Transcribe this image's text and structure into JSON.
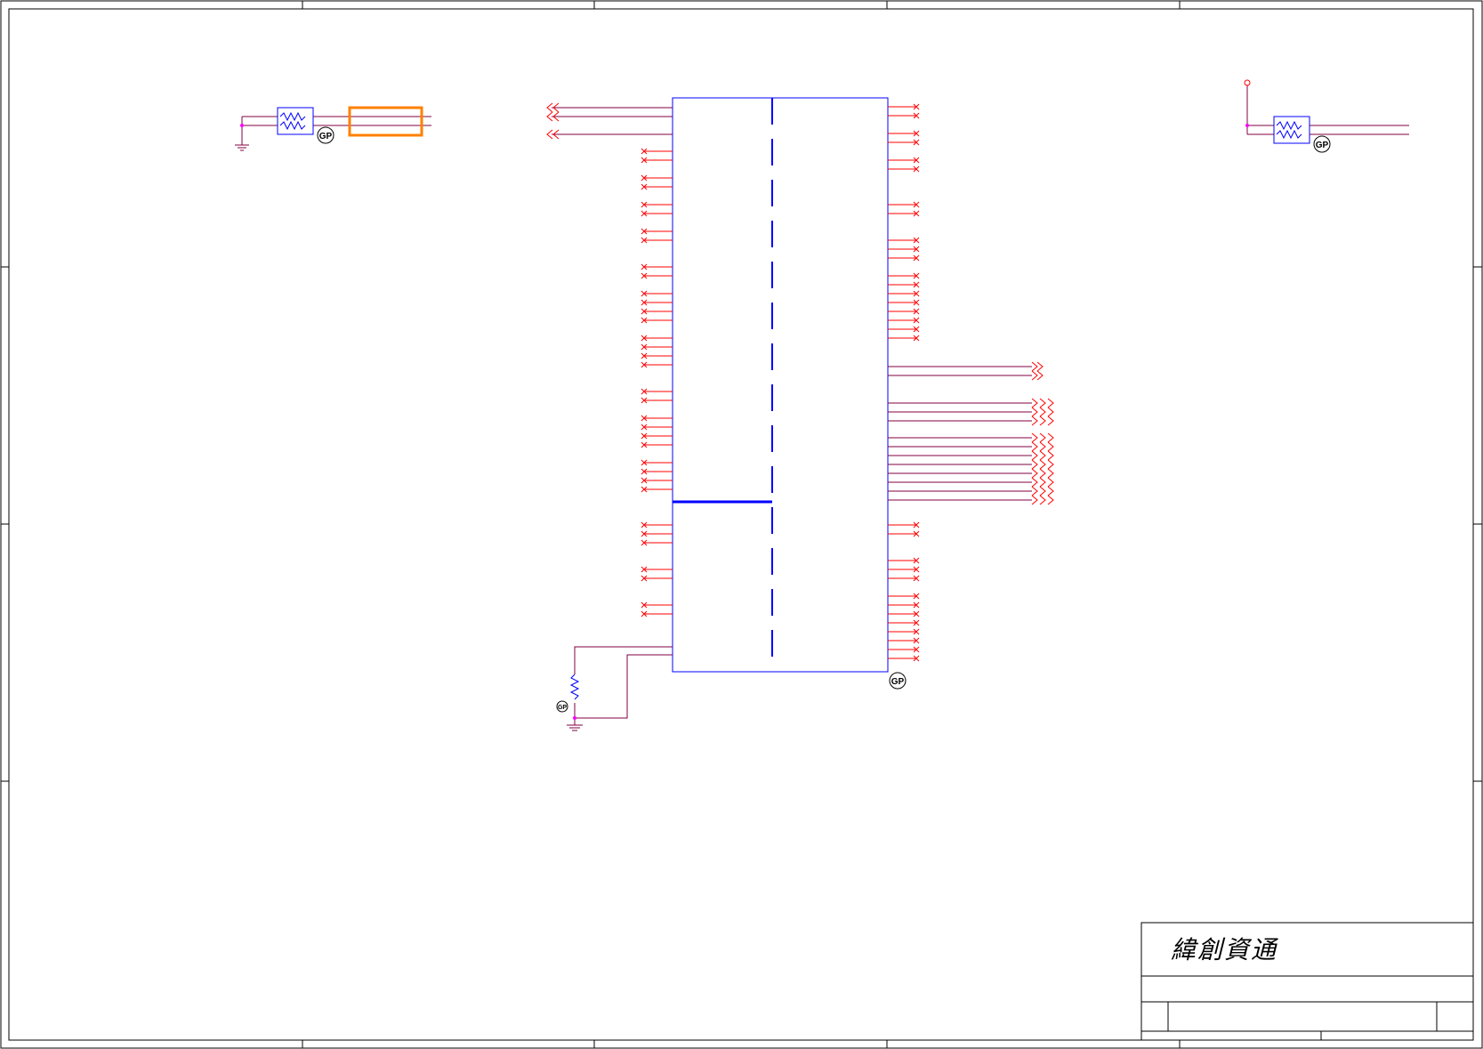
{
  "title_block": {
    "company_logo": "緯創資通"
  },
  "colors": {
    "wire": "#ff0000",
    "net": "#800040",
    "part": "#0000ff",
    "fuse": "#ff8000",
    "junction": "#ff00ff",
    "border": "#000000"
  },
  "markers": {
    "green_part_label": "GP"
  }
}
